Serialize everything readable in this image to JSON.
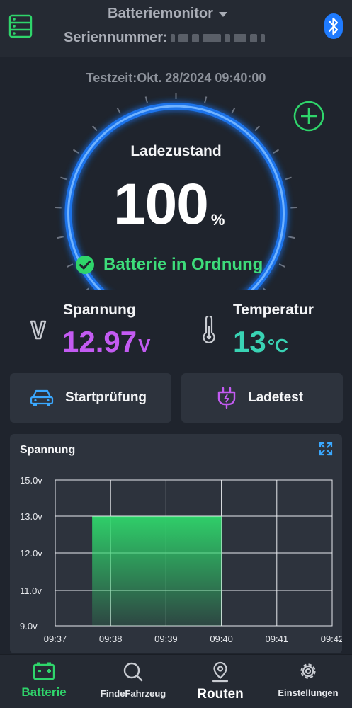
{
  "header": {
    "title": "Batteriemonitor",
    "serial_label": "Seriennummer:",
    "menu_icon": "menu-list-icon",
    "bluetooth_icon": "bluetooth-icon"
  },
  "test_time": "Testzeit:Okt. 28/2024 09:40:00",
  "gauge": {
    "label": "Ladezustand",
    "value": "100",
    "unit": "%",
    "percent": 1.0,
    "status": "Batterie in Ordnung",
    "accent_color": "#1f7bff",
    "status_color": "#3ddc7a"
  },
  "voltage": {
    "label": "Spannung",
    "value": "12.97",
    "unit": "V",
    "color": "#c35bf2",
    "icon": "voltage-v-icon"
  },
  "temperature": {
    "label": "Temperatur",
    "value": "13",
    "unit": "°C",
    "color": "#39d3b4",
    "icon": "thermometer-icon"
  },
  "actions": {
    "start_test": "Startprüfung",
    "charge_test": "Ladetest"
  },
  "chart_data": {
    "type": "area",
    "title": "Spannung",
    "y_tick_labels": [
      "15.0v",
      "13.0v",
      "12.0v",
      "11.0v",
      "9.0v"
    ],
    "x_tick_labels": [
      "09:37",
      "09:38",
      "09:39",
      "09:40",
      "09:41",
      "09:42"
    ],
    "series": [
      {
        "x": [
          "09:37:40",
          "09:40:00"
        ],
        "values": [
          12.97,
          12.97
        ],
        "color": "#2fd56b"
      }
    ],
    "grid": true
  },
  "nav": {
    "items": [
      {
        "label": "Batterie",
        "icon": "battery-icon",
        "active": true
      },
      {
        "label": "FindeFahrzeug",
        "icon": "search-icon",
        "active": false
      },
      {
        "label": "Routen",
        "icon": "location-pin-icon",
        "active": false
      },
      {
        "label": "Einstellungen",
        "icon": "gear-icon",
        "active": false
      }
    ],
    "active_color": "#2fd56b"
  }
}
